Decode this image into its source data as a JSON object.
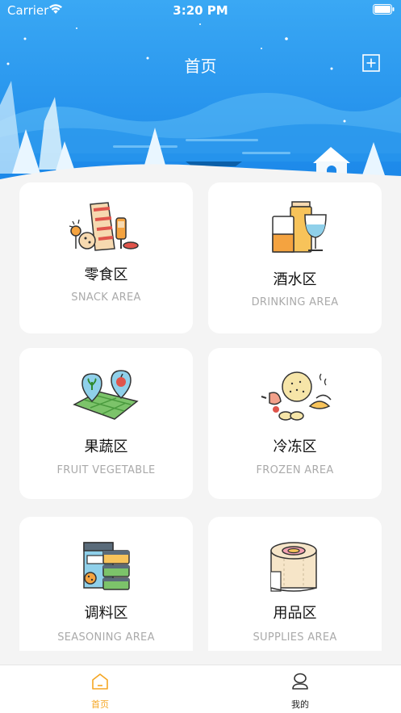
{
  "status_bar": {
    "carrier": "Carrier",
    "time": "3:20 PM"
  },
  "nav": {
    "title": "首页",
    "add_icon": "plus-square-icon"
  },
  "categories": [
    {
      "title": "零食区",
      "subtitle": "SNACK AREA",
      "icon": "snack-icon"
    },
    {
      "title": "酒水区",
      "subtitle": "DRINKING AREA",
      "icon": "drinks-icon"
    },
    {
      "title": "果蔬区",
      "subtitle": "FRUIT VEGETABLE",
      "icon": "fruit-vegetable-icon"
    },
    {
      "title": "冷冻区",
      "subtitle": "FROZEN AREA",
      "icon": "frozen-food-icon"
    },
    {
      "title": "调料区",
      "subtitle": "SEASONING AREA",
      "icon": "seasoning-icon"
    },
    {
      "title": "用品区",
      "subtitle": "SUPPLIES AREA",
      "icon": "tissue-roll-icon"
    }
  ],
  "tabs": [
    {
      "label": "首页",
      "icon": "home-icon",
      "active": true
    },
    {
      "label": "我的",
      "icon": "profile-icon",
      "active": false
    }
  ],
  "colors": {
    "accent": "#f5a623",
    "sky_top": "#3aa5f3",
    "sky_bottom": "#1f86e6"
  }
}
